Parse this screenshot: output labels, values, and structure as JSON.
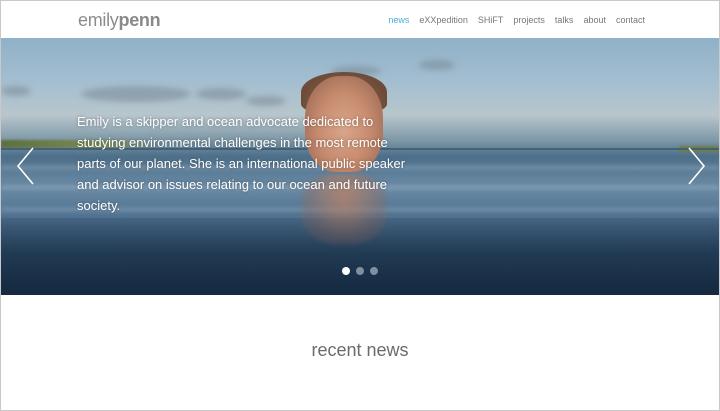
{
  "site": {
    "logo_first": "emily",
    "logo_last": "penn"
  },
  "nav": {
    "items": [
      {
        "label": "news",
        "active": true
      },
      {
        "label": "eXXpedition",
        "active": false
      },
      {
        "label": "SHiFT",
        "active": false
      },
      {
        "label": "projects",
        "active": false
      },
      {
        "label": "talks",
        "active": false
      },
      {
        "label": "about",
        "active": false
      },
      {
        "label": "contact",
        "active": false
      }
    ]
  },
  "hero": {
    "caption": "Emily is a skipper and ocean advocate dedicated to studying environmental challenges in the most remote parts of our planet. She is an international public speaker and advisor on issues relating to our ocean and future society.",
    "slides_total": 3,
    "active_slide": 1,
    "prev_icon": "chevron-left-icon",
    "next_icon": "chevron-right-icon"
  },
  "news": {
    "title": "recent news"
  },
  "colors": {
    "accent": "#4aaed8",
    "logo": "#8c8c8c",
    "nav_text": "#777777"
  }
}
